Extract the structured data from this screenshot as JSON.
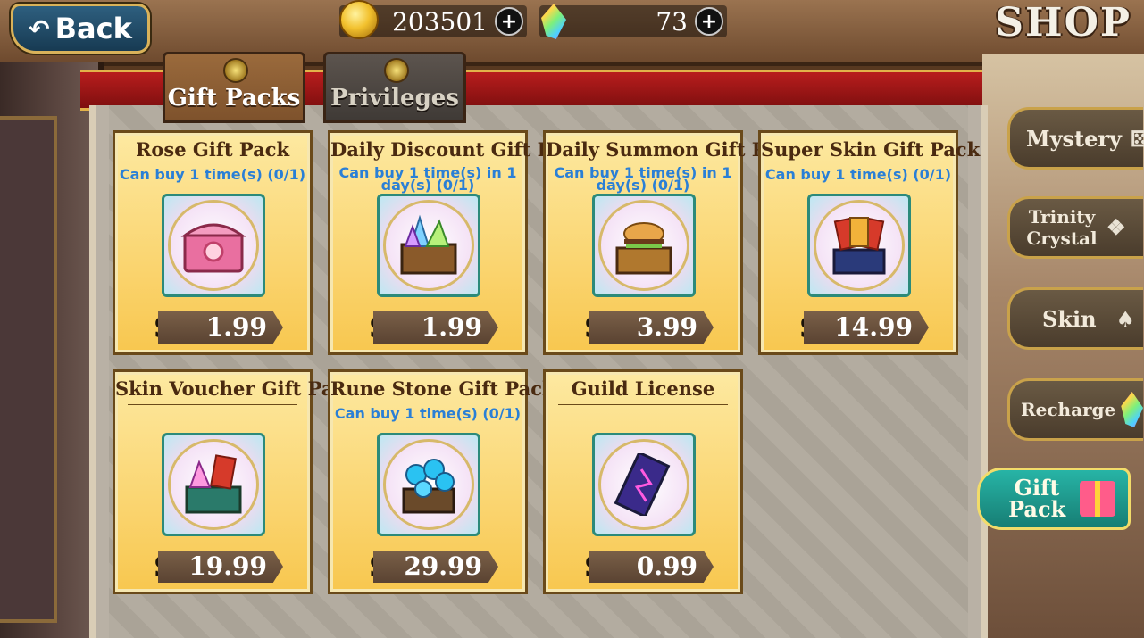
{
  "header": {
    "back_label": "Back",
    "gold": "203501",
    "gems": "73",
    "shop_title": "SHOP"
  },
  "tabs": [
    {
      "label": "Gift Packs",
      "active": true
    },
    {
      "label": "Privileges",
      "active": false
    }
  ],
  "cards": [
    {
      "title": "Rose Gift Pack",
      "limit": "Can buy 1 time(s) (0/1)",
      "price": "1.99",
      "icon": "rose-chest-icon"
    },
    {
      "title": "Daily Discount Gift Pack",
      "limit": "Can buy 1 time(s) in 1 day(s) (0/1)",
      "price": "1.99",
      "icon": "crystal-chest-icon"
    },
    {
      "title": "Daily Summon Gift Pack",
      "limit": "Can buy 1 time(s) in 1 day(s) (0/1)",
      "price": "3.99",
      "icon": "burger-chest-icon"
    },
    {
      "title": "Super Skin Gift Pack",
      "limit": "Can buy 1 time(s) (0/1)",
      "price": "14.99",
      "icon": "card-chest-icon"
    },
    {
      "title": "Skin Voucher Gift Pack",
      "limit": "",
      "price": "19.99",
      "icon": "voucher-chest-icon"
    },
    {
      "title": "Rune Stone Gift Pack",
      "limit": "Can buy 1 time(s) (0/1)",
      "price": "29.99",
      "icon": "rune-chest-icon"
    },
    {
      "title": "Guild License",
      "limit": "",
      "price": "0.99",
      "icon": "license-scroll-icon"
    }
  ],
  "currency_symbol": "$",
  "side_menu": [
    {
      "label": "Mystery",
      "icon": "dice-icon"
    },
    {
      "label": "Trinity Crystal",
      "icon": "crystal-icon"
    },
    {
      "label": "Skin",
      "icon": "costume-icon"
    },
    {
      "label": "Recharge",
      "icon": "gem-icon"
    },
    {
      "label": "Gift Pack",
      "icon": "gift-icon",
      "active": true
    }
  ],
  "colors": {
    "card_gold": "#f8c74f",
    "limit_blue": "#2a7fd6",
    "price_bar": "#5a4332",
    "tab_active": "#7e522c",
    "ribbon_red": "#b81d1d"
  }
}
